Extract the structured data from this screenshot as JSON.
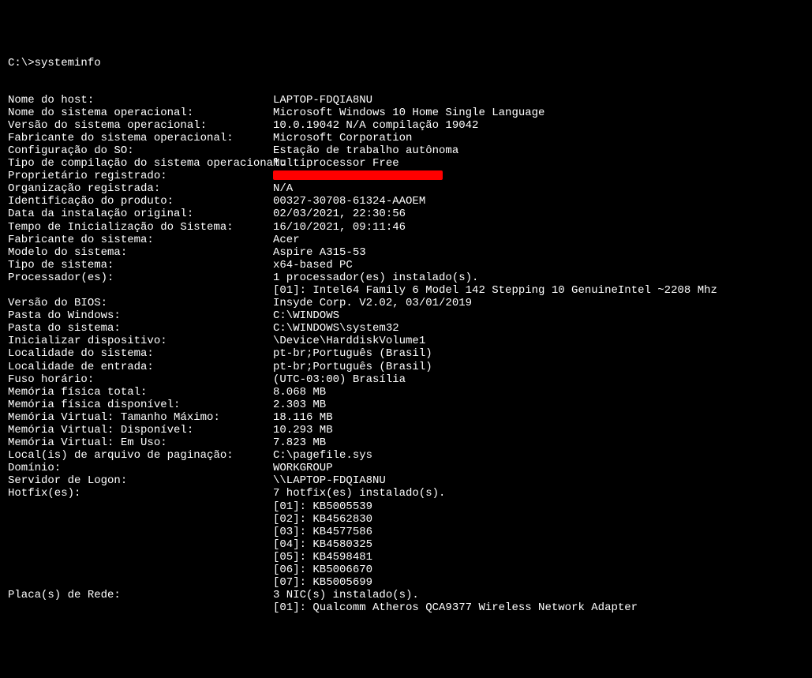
{
  "prompt": "C:\\>systeminfo",
  "rows": [
    {
      "label": "Nome do host:",
      "value": "LAPTOP-FDQIA8NU"
    },
    {
      "label": "Nome do sistema operacional:",
      "value": "Microsoft Windows 10 Home Single Language"
    },
    {
      "label": "Versão do sistema operacional:",
      "value": "10.0.19042 N/A compilação 19042"
    },
    {
      "label": "Fabricante do sistema operacional:",
      "value": "Microsoft Corporation"
    },
    {
      "label": "Configuração do SO:",
      "value": "Estação de trabalho autônoma"
    },
    {
      "label": "Tipo de compilação do sistema operacional:",
      "value": "Multiprocessor Free"
    },
    {
      "label": "Proprietário registrado:",
      "value": "",
      "redacted": true
    },
    {
      "label": "Organização registrada:",
      "value": "N/A"
    },
    {
      "label": "Identificação do produto:",
      "value": "00327-30708-61324-AAOEM"
    },
    {
      "label": "Data da instalação original:",
      "value": "02/03/2021, 22:30:56"
    },
    {
      "label": "Tempo de Inicialização do Sistema:",
      "value": "16/10/2021, 09:11:46"
    },
    {
      "label": "Fabricante do sistema:",
      "value": "Acer"
    },
    {
      "label": "Modelo do sistema:",
      "value": "Aspire A315-53"
    },
    {
      "label": "Tipo de sistema:",
      "value": "x64-based PC"
    },
    {
      "label": "Processador(es):",
      "value": "1 processador(es) instalado(s)."
    },
    {
      "label": "",
      "value": "[01]: Intel64 Family 6 Model 142 Stepping 10 GenuineIntel ~2208 Mhz",
      "indented": true
    },
    {
      "label": "Versão do BIOS:",
      "value": "Insyde Corp. V2.02, 03/01/2019"
    },
    {
      "label": "Pasta do Windows:",
      "value": "C:\\WINDOWS"
    },
    {
      "label": "Pasta do sistema:",
      "value": "C:\\WINDOWS\\system32"
    },
    {
      "label": "Inicializar dispositivo:",
      "value": "\\Device\\HarddiskVolume1"
    },
    {
      "label": "Localidade do sistema:",
      "value": "pt-br;Português (Brasil)"
    },
    {
      "label": "Localidade de entrada:",
      "value": "pt-br;Português (Brasil)"
    },
    {
      "label": "Fuso horário:",
      "value": "(UTC-03:00) Brasília"
    },
    {
      "label": "Memória física total:",
      "value": "8.068 MB"
    },
    {
      "label": "Memória física disponível:",
      "value": "2.303 MB"
    },
    {
      "label": "Memória Virtual: Tamanho Máximo:",
      "value": "18.116 MB"
    },
    {
      "label": "Memória Virtual: Disponível:",
      "value": "10.293 MB"
    },
    {
      "label": "Memória Virtual: Em Uso:",
      "value": "7.823 MB"
    },
    {
      "label": "Local(is) de arquivo de paginação:",
      "value": "C:\\pagefile.sys"
    },
    {
      "label": "Domínio:",
      "value": "WORKGROUP"
    },
    {
      "label": "Servidor de Logon:",
      "value": "\\\\LAPTOP-FDQIA8NU"
    },
    {
      "label": "Hotfix(es):",
      "value": "7 hotfix(es) instalado(s)."
    },
    {
      "label": "",
      "value": "[01]: KB5005539",
      "indented": true
    },
    {
      "label": "",
      "value": "[02]: KB4562830",
      "indented": true
    },
    {
      "label": "",
      "value": "[03]: KB4577586",
      "indented": true
    },
    {
      "label": "",
      "value": "[04]: KB4580325",
      "indented": true
    },
    {
      "label": "",
      "value": "[05]: KB4598481",
      "indented": true
    },
    {
      "label": "",
      "value": "[06]: KB5006670",
      "indented": true
    },
    {
      "label": "",
      "value": "[07]: KB5005699",
      "indented": true
    },
    {
      "label": "Placa(s) de Rede:",
      "value": "3 NIC(s) instalado(s)."
    },
    {
      "label": "",
      "value": "[01]: Qualcomm Atheros QCA9377 Wireless Network Adapter",
      "indented": true
    }
  ]
}
